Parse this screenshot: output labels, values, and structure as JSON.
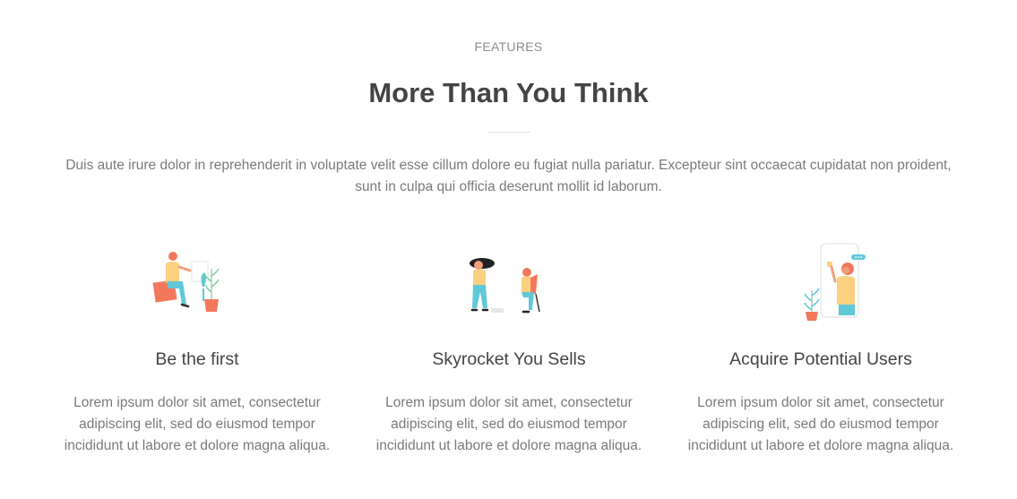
{
  "section": {
    "eyebrow": "FEATURES",
    "title": "More Than You Think",
    "intro": "Duis aute irure dolor in reprehenderit in voluptate velit esse cillum dolore eu fugiat nulla pariatur. Excepteur sint occaecat cupidatat non proident, sunt in culpa qui officia deserunt mollit id laborum."
  },
  "features": [
    {
      "icon": "person-with-plants-illustration",
      "title": "Be the first",
      "text": "Lorem ipsum dolor sit amet, consectetur adipiscing elit, sed do eiusmod tempor incididunt ut labore et dolore magna aliqua."
    },
    {
      "icon": "two-people-talking-illustration",
      "title": "Skyrocket You Sells",
      "text": "Lorem ipsum dolor sit amet, consectetur adipiscing elit, sed do eiusmod tempor incididunt ut labore et dolore magna aliqua."
    },
    {
      "icon": "person-in-phone-illustration",
      "title": "Acquire Potential Users",
      "text": "Lorem ipsum dolor sit amet, consectetur adipiscing elit, sed do eiusmod tempor incididunt ut labore et dolore magna aliqua."
    }
  ],
  "colors": {
    "heading": "#444444",
    "body": "#7a7a7a",
    "accent_coral": "#f2785c",
    "accent_teal": "#5fc9d8",
    "accent_yellow": "#fbd17f"
  }
}
